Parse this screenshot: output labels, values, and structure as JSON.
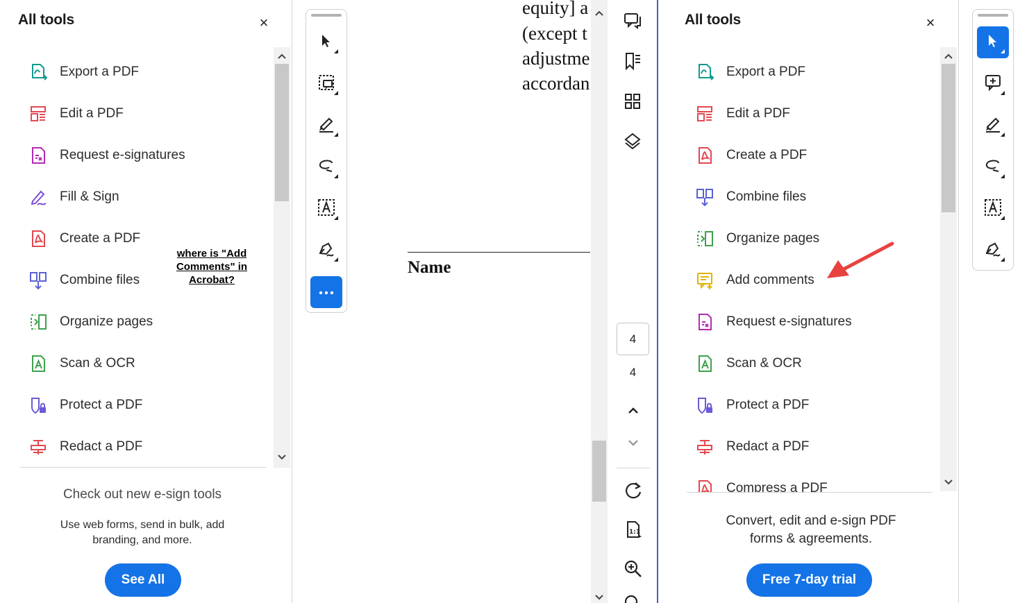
{
  "left_panel": {
    "title": "All tools",
    "close_glyph": "×",
    "tools": [
      {
        "label": "Export a PDF",
        "icon": "export-pdf-icon",
        "color": "#0f9a8e"
      },
      {
        "label": "Edit a PDF",
        "icon": "edit-pdf-icon",
        "color": "#e34850"
      },
      {
        "label": "Request e-signatures",
        "icon": "request-esign-icon",
        "color": "#b42ab4"
      },
      {
        "label": "Fill & Sign",
        "icon": "fill-sign-icon",
        "color": "#7c4dd6"
      },
      {
        "label": "Create a PDF",
        "icon": "create-pdf-icon",
        "color": "#e34850"
      },
      {
        "label": "Combine files",
        "icon": "combine-files-icon",
        "color": "#5a62d6"
      },
      {
        "label": "Organize pages",
        "icon": "organize-pages-icon",
        "color": "#3ea04c"
      },
      {
        "label": "Scan & OCR",
        "icon": "scan-ocr-icon",
        "color": "#3ea04c"
      },
      {
        "label": "Protect a PDF",
        "icon": "protect-pdf-icon",
        "color": "#6a5bd6"
      },
      {
        "label": "Redact a PDF",
        "icon": "redact-pdf-icon",
        "color": "#e34850"
      }
    ],
    "promo_title": "Check out new e-sign tools",
    "promo_text_1": "Use web forms, send in bulk, add",
    "promo_text_2": "branding, and more.",
    "button_label": "See All"
  },
  "annotation": {
    "line1": "where is \"Add",
    "line2": "Comments\" in",
    "line3": "Acrobat?"
  },
  "document": {
    "lines": [
      "equity] a",
      "(except t",
      "adjustme",
      "accordan"
    ],
    "heading": "Name"
  },
  "right_rail": {
    "page_current": "4",
    "page_total": "4"
  },
  "right_panel": {
    "title": "All tools",
    "close_glyph": "×",
    "tools": [
      {
        "label": "Export a PDF",
        "icon": "export-pdf-icon",
        "color": "#0f9a8e"
      },
      {
        "label": "Edit a PDF",
        "icon": "edit-pdf-icon",
        "color": "#e34850"
      },
      {
        "label": "Create a PDF",
        "icon": "create-pdf-icon",
        "color": "#e34850"
      },
      {
        "label": "Combine files",
        "icon": "combine-files-icon",
        "color": "#5a62d6"
      },
      {
        "label": "Organize pages",
        "icon": "organize-pages-icon",
        "color": "#3ea04c"
      },
      {
        "label": "Add comments",
        "icon": "add-comments-icon",
        "color": "#e0b400"
      },
      {
        "label": "Request e-signatures",
        "icon": "request-esign-icon",
        "color": "#b42ab4"
      },
      {
        "label": "Scan & OCR",
        "icon": "scan-ocr-icon",
        "color": "#3ea04c"
      },
      {
        "label": "Protect a PDF",
        "icon": "protect-pdf-icon",
        "color": "#6a5bd6"
      },
      {
        "label": "Redact a PDF",
        "icon": "redact-pdf-icon",
        "color": "#e34850"
      },
      {
        "label": "Compress a PDF",
        "icon": "compress-pdf-icon",
        "color": "#e34850"
      }
    ],
    "promo_text_1": "Convert, edit and e-sign PDF",
    "promo_text_2": "forms & agreements.",
    "button_label": "Free 7-day trial"
  },
  "colors": {
    "accent_blue": "#1473e6",
    "arrow_red": "#e8423f"
  }
}
